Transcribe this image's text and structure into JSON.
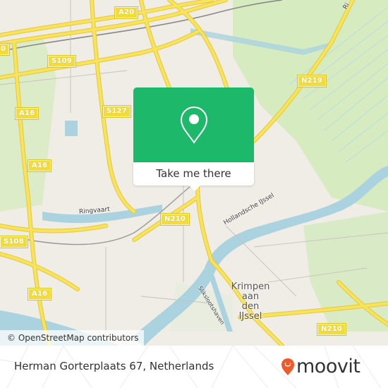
{
  "map": {
    "road_shields": [
      {
        "id": "a20",
        "label": "A20"
      },
      {
        "id": "s109",
        "label": "S109"
      },
      {
        "id": "a16-top",
        "label": "A16"
      },
      {
        "id": "s127",
        "label": "S127"
      },
      {
        "id": "n219",
        "label": "N219"
      },
      {
        "id": "a16-mid",
        "label": "A16"
      },
      {
        "id": "s108",
        "label": "S108"
      },
      {
        "id": "n210-center",
        "label": "N210"
      },
      {
        "id": "a16-bottom",
        "label": "A16"
      },
      {
        "id": "n210-bottom",
        "label": "N210"
      },
      {
        "id": "a20-left-edge",
        "label": "0"
      }
    ],
    "labels": {
      "ringvaart": "Ringvaart",
      "hollandsche_ijssel": "Hollandsche IJssel",
      "slikslootshaven": "Slikslootshaven",
      "top_right_street": "Ri"
    },
    "city": {
      "name_lines": [
        "Krimpen",
        "aan",
        "den",
        "IJssel"
      ]
    },
    "colors": {
      "land": "#f0ece6",
      "water": "#aad3df",
      "green": "#cfe8b5",
      "major_road": "#f7e35f",
      "accent_green": "#1db86a"
    },
    "attribution": "© OpenStreetMap contributors"
  },
  "popup": {
    "icon": "map-pin-icon",
    "button_label": "Take me there"
  },
  "footer": {
    "address": "Herman Gorterplaats 67, Netherlands",
    "brand": "moovit",
    "brand_color": "#f05a28"
  }
}
